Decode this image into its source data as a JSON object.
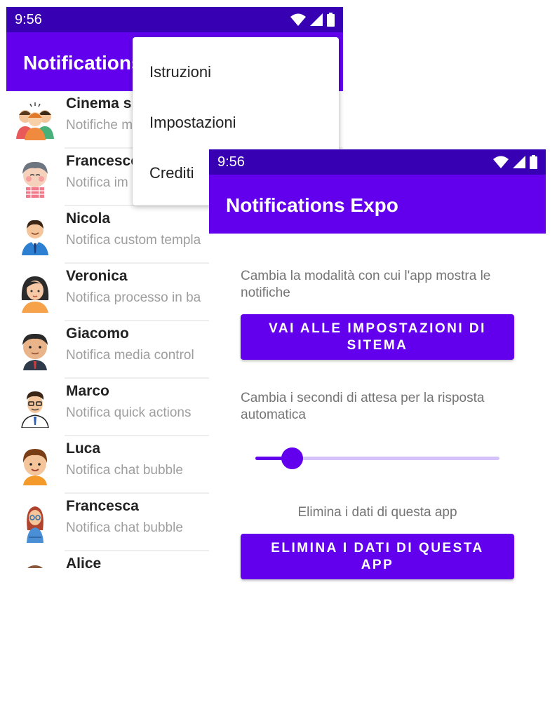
{
  "status_bar": {
    "time": "9:56"
  },
  "list_screen": {
    "app_title": "Notifications Expo",
    "contacts": [
      {
        "name": "Cinema s",
        "subtitle": "Notifiche m",
        "avatar_icon": "group-avatar-icon"
      },
      {
        "name": "Francesco",
        "subtitle": "Notifica im",
        "avatar_icon": "boy-avatar-icon"
      },
      {
        "name": "Nicola",
        "subtitle": "Notifica custom templa",
        "avatar_icon": "man-tie-avatar-icon"
      },
      {
        "name": "Veronica",
        "subtitle": "Notifica processo in ba",
        "avatar_icon": "woman-avatar-icon"
      },
      {
        "name": "Giacomo",
        "subtitle": "Notifica media control",
        "avatar_icon": "man-avatar-icon"
      },
      {
        "name": "Marco",
        "subtitle": "Notifica quick actions",
        "avatar_icon": "man-glasses-avatar-icon"
      },
      {
        "name": "Luca",
        "subtitle": "Notifica chat bubble",
        "avatar_icon": "boy-smile-avatar-icon"
      },
      {
        "name": "Francesca",
        "subtitle": "Notifica chat bubble",
        "avatar_icon": "girl-glasses-avatar-icon"
      },
      {
        "name": "Alice",
        "subtitle": "",
        "avatar_icon": "girl-avatar-icon"
      }
    ]
  },
  "overflow_menu": {
    "items": [
      "Istruzioni",
      "Impostazioni",
      "Crediti"
    ]
  },
  "settings_screen": {
    "app_title": "Notifications Expo",
    "mode_description": "Cambia la modalità con cui l'app mostra le notifiche",
    "system_settings_button": "VAI ALLE IMPOSTAZIONI DI SITEMA",
    "wait_description": "Cambia i secondi di attesa per la risposta automatica",
    "slider_fraction": 0.15,
    "clear_description": "Elimina i dati di questa app",
    "clear_button": "ELIMINA I DATI DI QUESTA APP"
  },
  "colors": {
    "status_bar": "#3700b3",
    "primary": "#6200ee",
    "slider_track": "#d5c2fb"
  }
}
